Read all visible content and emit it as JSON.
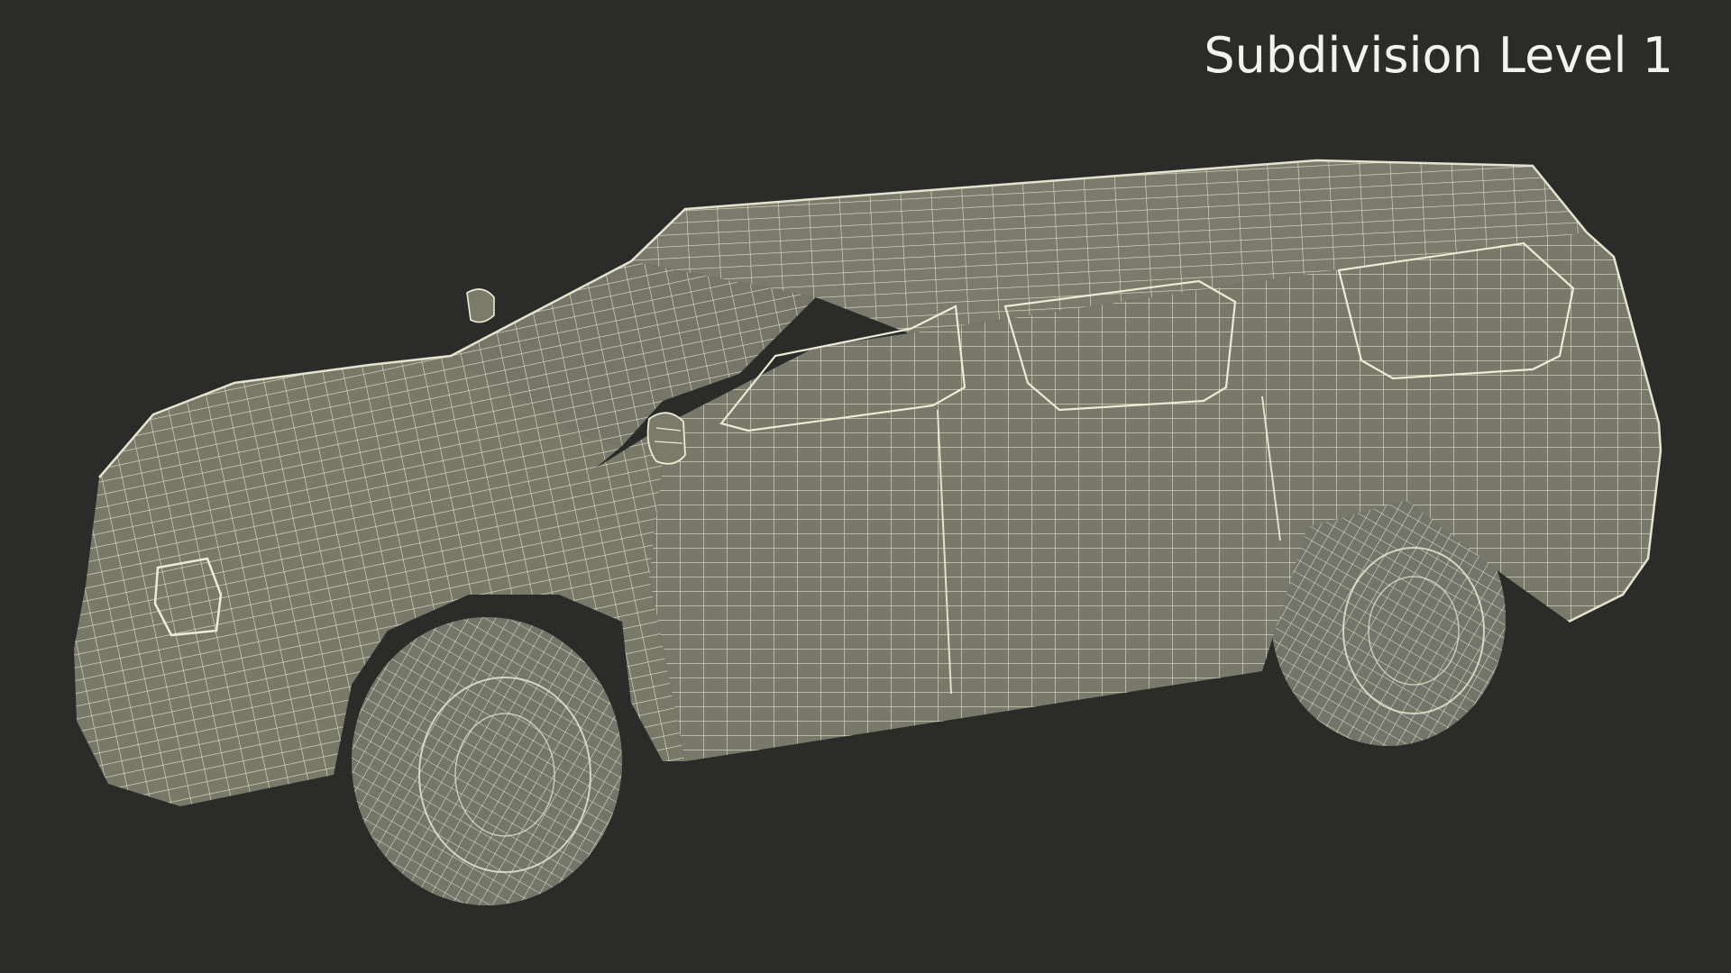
{
  "caption": "Subdivision Level 1",
  "colors": {
    "background": "#2b2b2a",
    "surface": "#78796a",
    "surface_shadow": "#66675a",
    "wire": "#ecebd6",
    "caption_text": "#f2f2ee"
  },
  "icons": {
    "object": "car-wireframe-model"
  }
}
